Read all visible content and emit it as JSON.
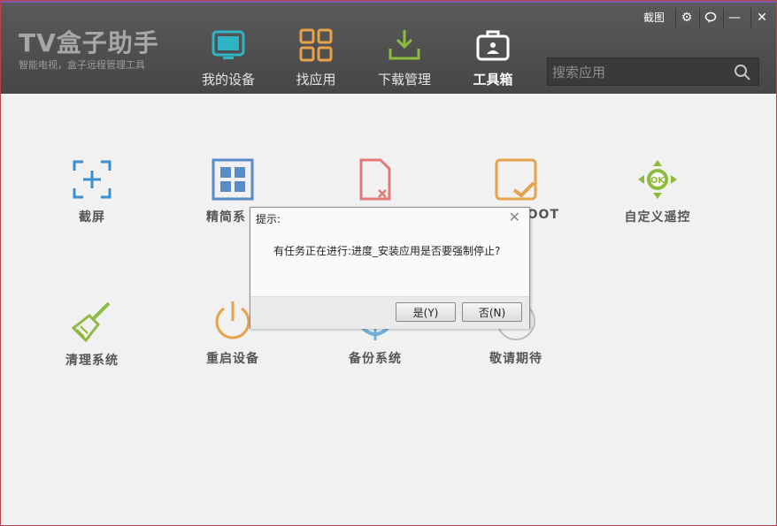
{
  "app": {
    "logo": "TV盒子助手",
    "logo_sub": "智能电视，盒子远程管理工具"
  },
  "window_controls": {
    "screenshot_label": "截图"
  },
  "nav": {
    "items": [
      {
        "label": "我的设备",
        "icon": "tv-icon",
        "color": "#2fb4c6"
      },
      {
        "label": "找应用",
        "icon": "apps-grid-icon",
        "color": "#e5a24a"
      },
      {
        "label": "下载管理",
        "icon": "download-icon",
        "color": "#8dbb3c"
      },
      {
        "label": "工具箱",
        "icon": "toolbox-icon",
        "color": "#ffffff",
        "active": true
      }
    ]
  },
  "search": {
    "placeholder": "搜索应用"
  },
  "tools": [
    {
      "label": "截屏",
      "icon": "screenshot-icon",
      "color": "#3a8fd0"
    },
    {
      "label": "精简系",
      "icon": "grid-simplify-icon",
      "color": "#5a8bc9"
    },
    {
      "label": "",
      "icon": "file-delete-icon",
      "color": "#e07b78"
    },
    {
      "label": "OOT",
      "icon": "root-check-icon",
      "color": "#e5a24a"
    },
    {
      "label": "自定义遥控",
      "icon": "remote-ok-icon",
      "color": "#8dbb3c"
    },
    {
      "label": "清理系统",
      "icon": "broom-icon",
      "color": "#8dbb3c"
    },
    {
      "label": "重启设备",
      "icon": "power-icon",
      "color": "#e5a24a"
    },
    {
      "label": "备份系统",
      "icon": "backup-icon",
      "color": "#3a8fd0"
    },
    {
      "label": "敬请期待",
      "icon": "more-icon",
      "color": "#9a9a9a"
    }
  ],
  "dialog": {
    "title": "提示:",
    "message": "有任务正在进行:进度_安装应用是否要强制停止?",
    "yes_label": "是(Y)",
    "no_label": "否(N)"
  }
}
